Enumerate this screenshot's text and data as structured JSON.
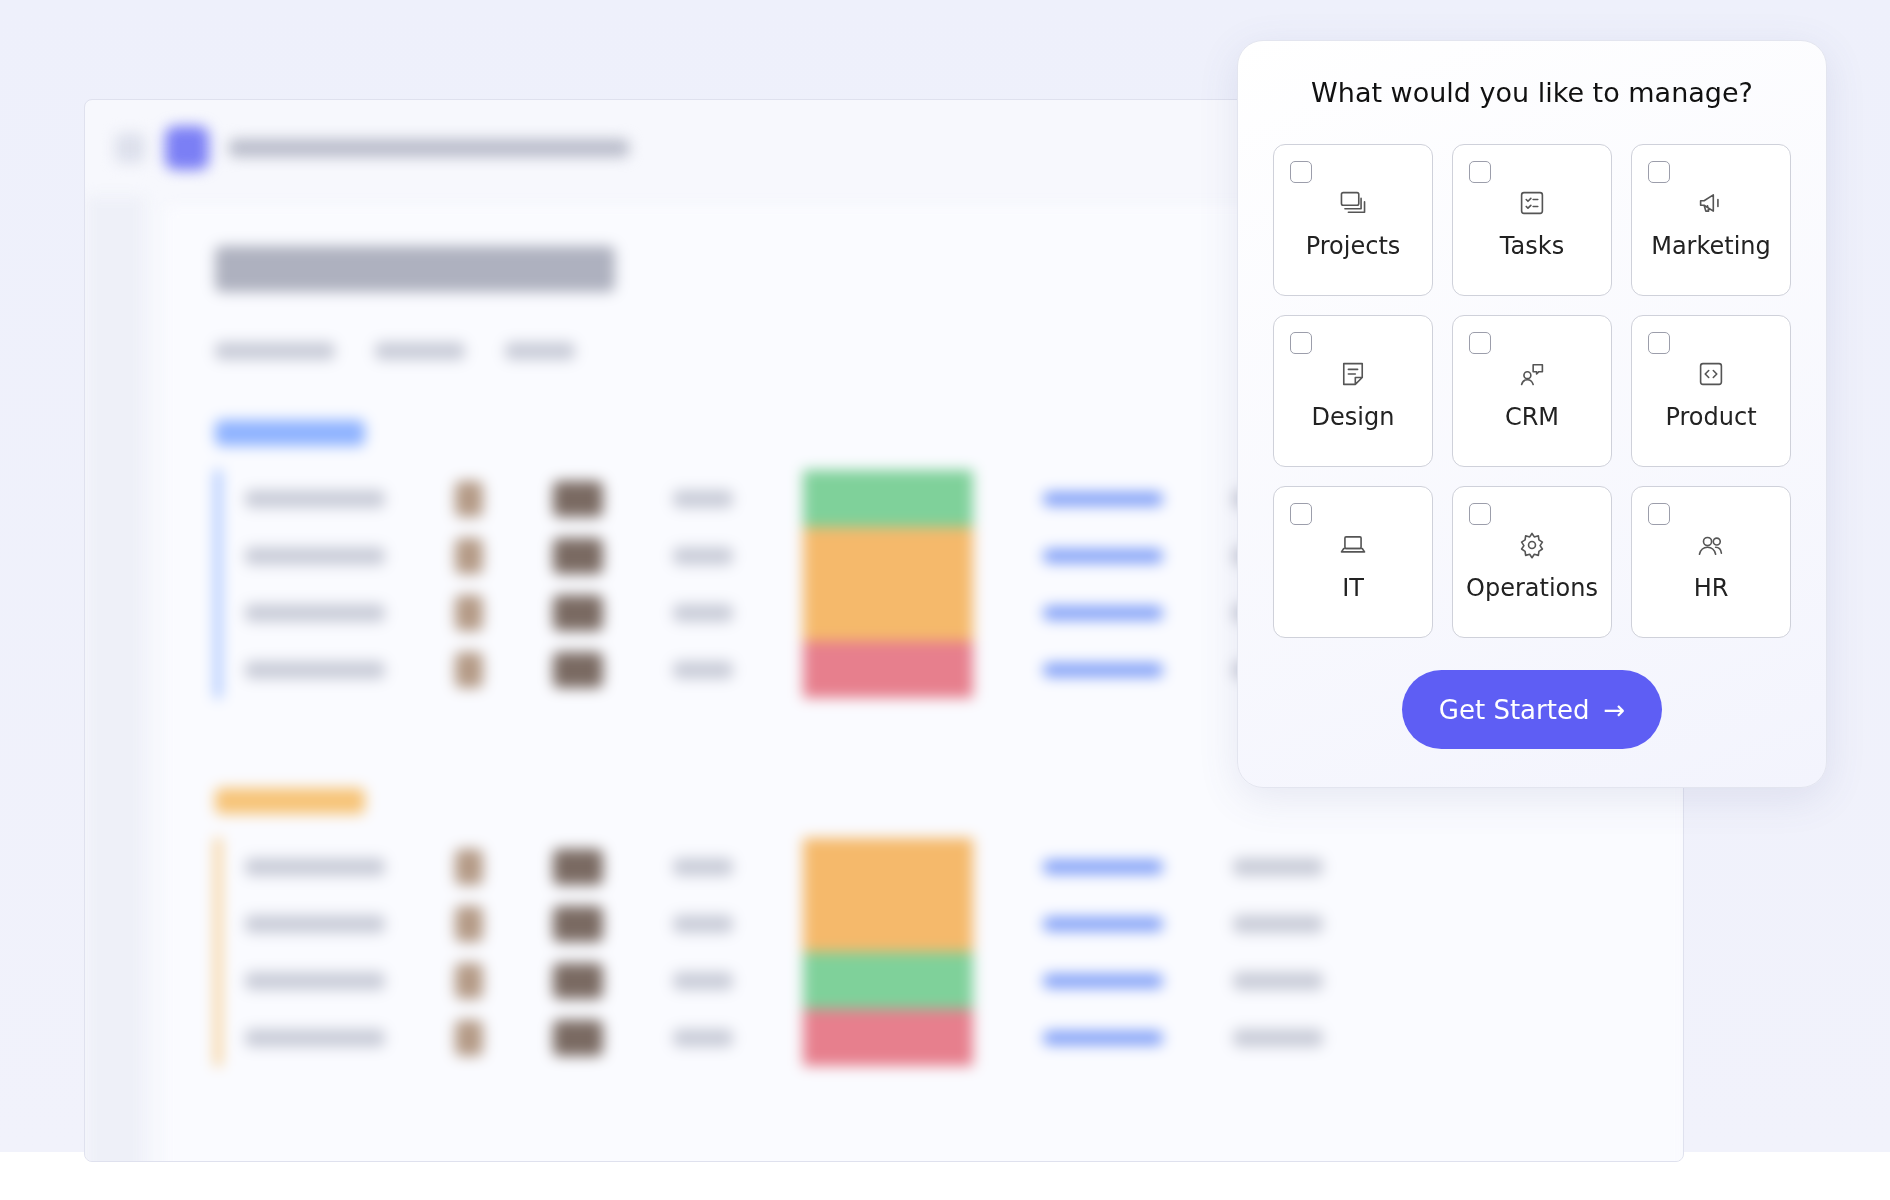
{
  "dialog": {
    "title": "What would you like to manage?",
    "options": [
      {
        "label": "Projects",
        "checked": false
      },
      {
        "label": "Tasks",
        "checked": false
      },
      {
        "label": "Marketing",
        "checked": false
      },
      {
        "label": "Design",
        "checked": false
      },
      {
        "label": "CRM",
        "checked": false
      },
      {
        "label": "Product",
        "checked": false
      },
      {
        "label": "IT",
        "checked": false
      },
      {
        "label": "Operations",
        "checked": false
      },
      {
        "label": "HR",
        "checked": false
      }
    ],
    "button": {
      "label": "Get Started",
      "icon": "→"
    }
  }
}
